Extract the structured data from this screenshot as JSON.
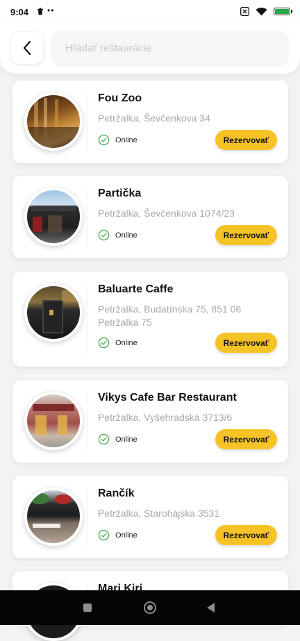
{
  "status_bar": {
    "time": "9:04",
    "dots": "••"
  },
  "search": {
    "placeholder": "Hľadať reštaurácie",
    "value": ""
  },
  "restaurants": [
    {
      "name": "Fou Zoo",
      "address": "Petržalka, Ševčenkova 34",
      "status": "Online",
      "button": "Rezervovať"
    },
    {
      "name": "Partička",
      "address": "Petržalka, Ševčenkova 1074/23",
      "status": "Online",
      "button": "Rezervovať"
    },
    {
      "name": "Baluarte Caffe",
      "address": "Petržalka, Budatínska 75, 851 06 Petržalka 75",
      "status": "Online",
      "button": "Rezervovať"
    },
    {
      "name": "Vikys Cafe Bar Restaurant",
      "address": "Petržalka, Vyšehradská 3713/6",
      "status": "Online",
      "button": "Rezervovať"
    },
    {
      "name": "Rančík",
      "address": "Petržalka, Starohájska 3531",
      "status": "Online",
      "button": "Rezervovať"
    },
    {
      "name": "Mari Kiri"
    }
  ],
  "colors": {
    "accent": "#f6c327",
    "online": "#4caf50",
    "nav_bar": "#050505"
  }
}
